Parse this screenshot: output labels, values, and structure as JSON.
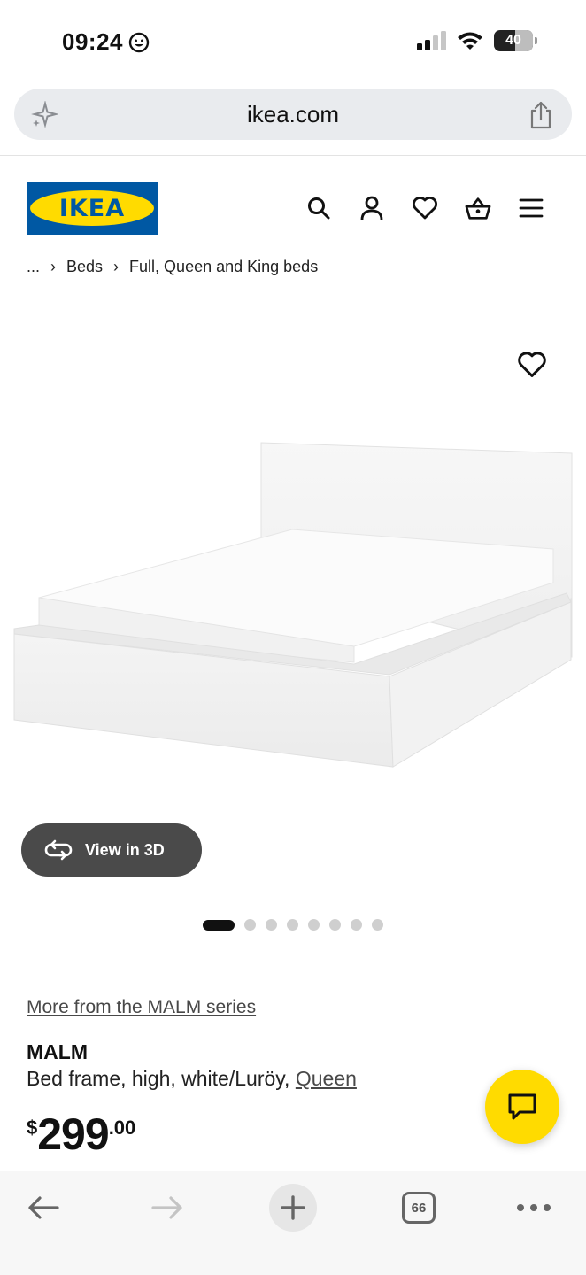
{
  "status_bar": {
    "time": "09:24",
    "battery": "40"
  },
  "browser": {
    "url": "ikea.com"
  },
  "header": {
    "logo_text": "IKEA",
    "brand_colors": {
      "blue": "#0058a3",
      "yellow": "#ffdb00"
    },
    "icons": [
      "search-icon",
      "account-icon",
      "favourites-icon",
      "basket-icon",
      "menu-icon"
    ]
  },
  "breadcrumb": {
    "ellipsis": "...",
    "separator": "›",
    "items": [
      "Beds",
      "Full, Queen and King beds"
    ]
  },
  "gallery": {
    "view_3d_label": "View in 3D",
    "slide_count": 8,
    "active_slide": 1
  },
  "product": {
    "series_link": "More from the MALM series",
    "name": "MALM",
    "description": "Bed frame, high, white/Luröy, ",
    "size_link": "Queen",
    "price": {
      "currency": "$",
      "integer": "299",
      "decimal": ".00"
    }
  },
  "toolbar": {
    "tab_count": "66"
  }
}
